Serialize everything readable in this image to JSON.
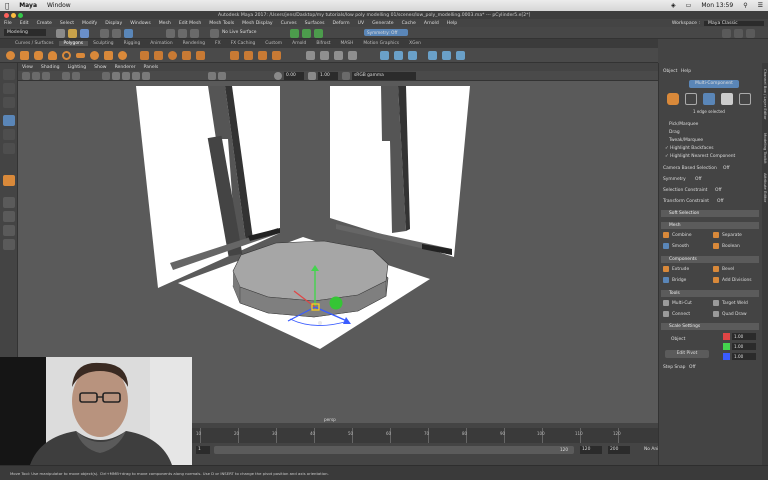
{
  "mac_menubar": {
    "apple": "",
    "app": "Maya",
    "window_menu": "Window",
    "clock": "Mon 13:59"
  },
  "title": "Autodesk Maya 2017: /Users/jens/Dasktop/my tutorials/low poly modelling 01/scenes/low_poly_modelling.0003.ma* --- pCylinder5.e[2*]",
  "menus": [
    "File",
    "Edit",
    "Create",
    "Select",
    "Modify",
    "Display",
    "Windows",
    "Mesh",
    "Edit Mesh",
    "Mesh Tools",
    "Mesh Display",
    "Curves",
    "Surfaces",
    "Deform",
    "UV",
    "Generate",
    "Cache",
    "Arnold",
    "Help"
  ],
  "status_line": {
    "mode": "Modeling",
    "live_surface": "No Live Surface",
    "symmetry": "Symmetry: Off",
    "workspace_label": "Workspace :",
    "workspace": "Maya Classic"
  },
  "shelf_tabs": [
    "Curves / Surfaces",
    "Polygons",
    "Sculpting",
    "Rigging",
    "Animation",
    "Rendering",
    "FX",
    "FX Caching",
    "Custom",
    "Arnold",
    "Bifrost",
    "MASH",
    "Motion Graphics",
    "XGen"
  ],
  "shelf_active": "Polygons",
  "panel_menus": [
    "View",
    "Shading",
    "Lighting",
    "Show",
    "Renderer",
    "Panels"
  ],
  "panel_toolbar": {
    "field1": "0.00",
    "field2": "1.00",
    "colorspace": "sRGB gamma"
  },
  "viewport": {
    "camera_label": "persp"
  },
  "timeline": {
    "ticks": [
      "10",
      "20",
      "30",
      "40",
      "50",
      "60",
      "70",
      "80",
      "90",
      "100",
      "110",
      "120"
    ],
    "current_frame": "1"
  },
  "range_slider": {
    "start": "1",
    "range_end": "120",
    "end": "120",
    "anim_end": "200",
    "anim_layer": "No Anim Layer",
    "char_set": "No Character Set"
  },
  "help_line": "Move Tool: Use manipulator to move object(s). Ctrl+MMB+drag to move components along normals. Use D or INSERT to change the pivot position and axis orientation.",
  "modeling_toolkit": {
    "header_menus": [
      "Object",
      "Help"
    ],
    "mode_label": "Multi-Component",
    "selection_info": "1 edge selected",
    "pick_marquee": "Pick/Marquee",
    "drag": "Drag",
    "tweak_marquee": "Tweak/Marquee",
    "highlight_backfaces": "Highlight Backfaces",
    "highlight_nearest": "Highlight Nearest Component",
    "camera_based": "Camera Based Selection",
    "camera_based_value": "Off",
    "symmetry": "Symmetry",
    "symmetry_value": "Off",
    "sel_constraint": "Selection Constraint",
    "sel_constraint_value": "Off",
    "transform_constraint": "Transform Constraint",
    "transform_constraint_value": "Off",
    "soft_selection": "Soft Selection",
    "mesh": "Mesh",
    "combine": "Combine",
    "separate": "Separate",
    "smooth": "Smooth",
    "boolean": "Boolean",
    "components": "Components",
    "extrude": "Extrude",
    "bevel": "Bevel",
    "bridge": "Bridge",
    "add_divisions": "Add Divisions",
    "tools": "Tools",
    "multi_cut": "Multi-Cut",
    "target_weld": "Target Weld",
    "connect": "Connect",
    "quad_draw": "Quad Draw",
    "scale_settings": "Scale Settings",
    "object": "Object",
    "edit_pivot": "Edit Pivot",
    "scale_x": "1.00",
    "scale_y": "1.00",
    "scale_z": "1.00",
    "step_snap": "Step Snap",
    "step_snap_value": "Off"
  },
  "side_tabs": [
    "Attribute Editor",
    "Modeling Toolkit",
    "Channel Box / Layer Editor"
  ]
}
